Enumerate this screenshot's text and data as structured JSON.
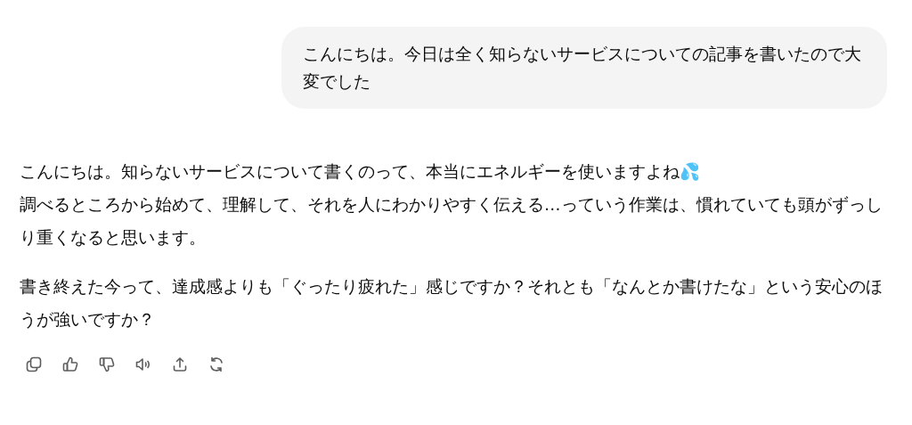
{
  "user_message": {
    "text": "こんにちは。今日は全く知らないサービスについての記事を書いたので大変でした"
  },
  "assistant_message": {
    "paragraphs": [
      "こんにちは。知らないサービスについて書くのって、本当にエネルギーを使いますよね💦\n調べるところから始めて、理解して、それを人にわかりやすく伝える…っていう作業は、慣れていても頭がずっしり重くなると思います。",
      "書き終えた今って、達成感よりも「ぐったり疲れた」感じですか？それとも「なんとか書けたな」という安心のほうが強いですか？"
    ]
  },
  "actions": [
    {
      "kind": "copy"
    },
    {
      "kind": "like"
    },
    {
      "kind": "dislike"
    },
    {
      "kind": "speak"
    },
    {
      "kind": "share"
    },
    {
      "kind": "regenerate"
    }
  ]
}
